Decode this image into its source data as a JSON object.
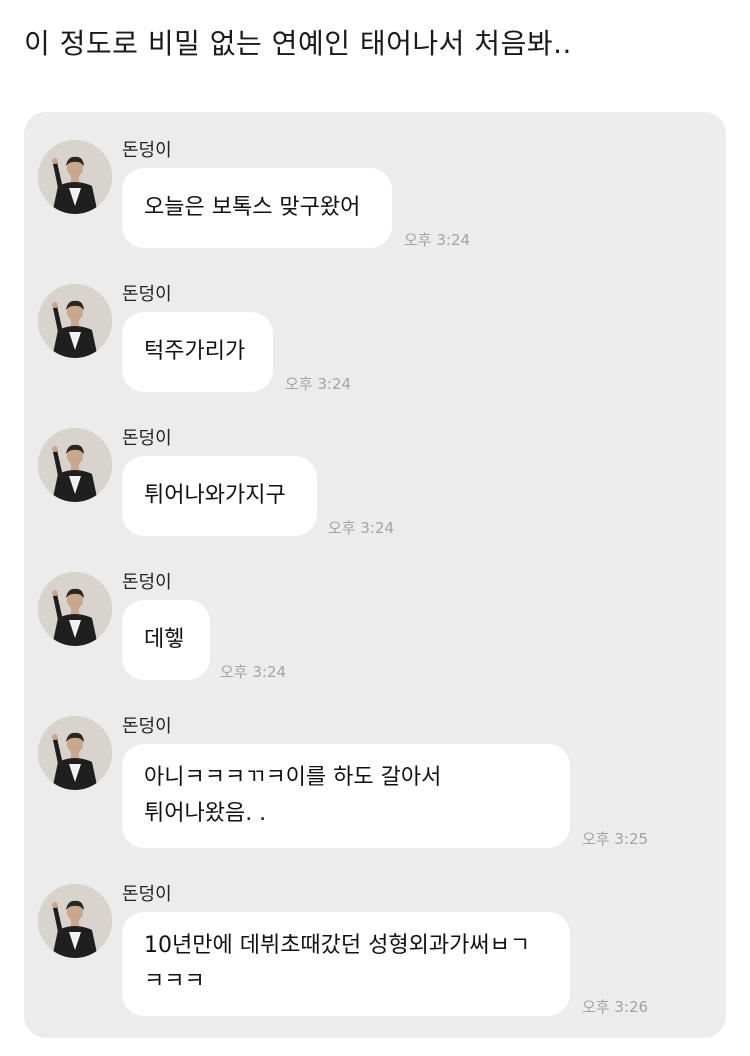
{
  "post": {
    "title": "이 정도로 비밀 없는 연예인 태어나서 처음봐.."
  },
  "messages": [
    {
      "sender": "돈덩이",
      "lines": [
        "오늘은 보톡스 맞구왔어"
      ],
      "time": "오후 3:24"
    },
    {
      "sender": "돈덩이",
      "lines": [
        "턱주가리가"
      ],
      "time": "오후 3:24"
    },
    {
      "sender": "돈덩이",
      "lines": [
        "튀어나와가지구"
      ],
      "time": "오후 3:24"
    },
    {
      "sender": "돈덩이",
      "lines": [
        "데헿"
      ],
      "time": "오후 3:24"
    },
    {
      "sender": "돈덩이",
      "lines": [
        "아니ㅋㅋㅋㄲㅋ이를 하도 갈아서",
        "튀어나왔음. ."
      ],
      "time": "오후 3:25"
    },
    {
      "sender": "돈덩이",
      "lines": [
        "10년만에 데뷔초때갔던 성형외과가써ㅂㄱ",
        "ㅋㅋㅋ"
      ],
      "time": "오후 3:26"
    }
  ],
  "icons": {
    "avatar": "profile-photo-avatar"
  },
  "colors": {
    "panel_bg": "#ececec",
    "bubble_bg": "#ffffff",
    "timestamp": "#a3a3a3"
  }
}
